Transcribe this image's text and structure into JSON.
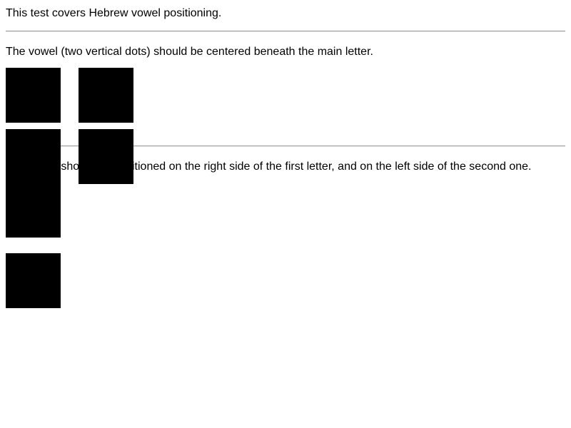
{
  "intro": {
    "text": "This test covers Hebrew vowel positioning."
  },
  "section1": {
    "description": "The vowel (two vertical dots) should be centered beneath the main letter."
  },
  "section2": {
    "description": "The vowel should be positioned on the right side of the first letter, and on the left side of the second one."
  },
  "colors": {
    "glyph_fill": "#000000",
    "rule": "#9a9a9a",
    "background": "#ffffff"
  }
}
